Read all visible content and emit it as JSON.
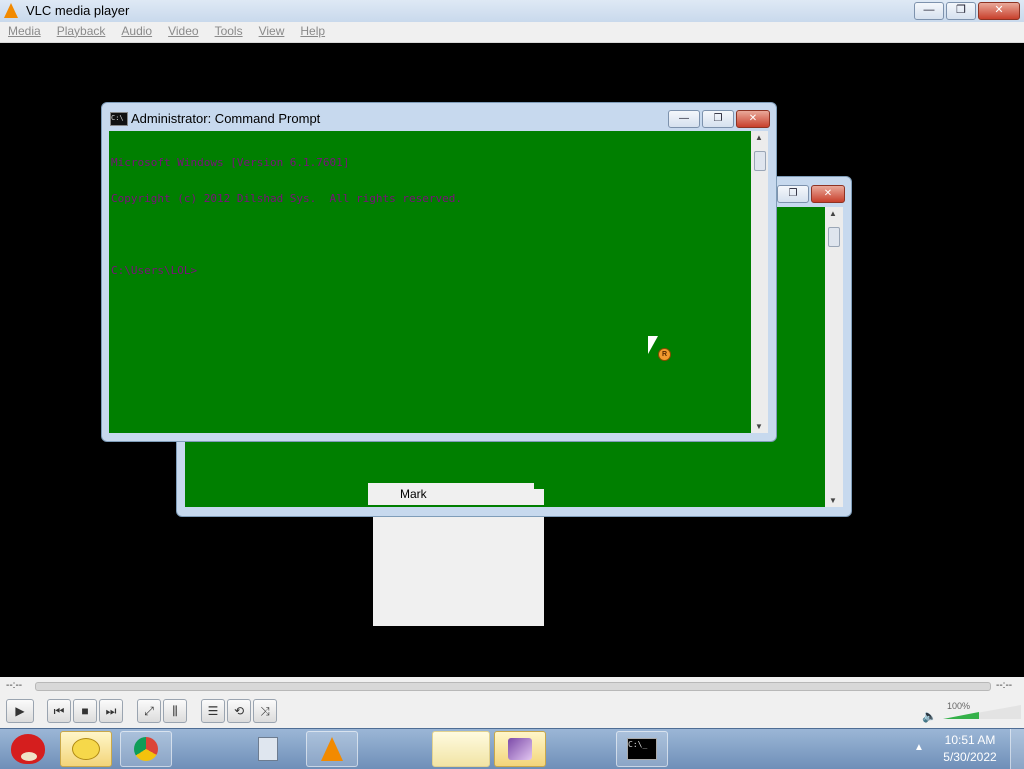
{
  "vlc": {
    "title": "VLC media player",
    "menu": [
      "Media",
      "Playback",
      "Audio",
      "Video",
      "Tools",
      "View",
      "Help"
    ],
    "window_buttons": {
      "minimize": "—",
      "restore": "❐",
      "close": "✕"
    }
  },
  "cmd": {
    "title": "Administrator: Command Prompt",
    "lines": [
      "Microsoft Windows [Version 6.1.7601]",
      "Copyright (c) 2012 Dilshad Sys.  All rights reserved.",
      "",
      "C:\\Users\\LOL>"
    ],
    "text_color": "#7b0f7b",
    "background": "#007f00"
  },
  "context_menu": {
    "items": [
      "Mark"
    ]
  },
  "cursor": {
    "badge": "R"
  },
  "player": {
    "elapsed": "--:--",
    "remaining": "--:--",
    "volume_label": "100%",
    "volume_level": 1.0,
    "buttons": {
      "play": "▶",
      "prev": "⏮",
      "stop": "■",
      "next": "⏭",
      "fullscreen": "⤢",
      "extended": "⫼",
      "playlist": "☰",
      "loop": "⟲",
      "shuffle": "⤨",
      "volume": "🔈"
    }
  },
  "taskbar": {
    "clock_time": "10:51 AM",
    "clock_date": "5/30/2022",
    "items": [
      "eggs-icon",
      "chrome-icon",
      "calculator-icon",
      "vlc-icon",
      "blank-window",
      "paint-icon",
      "cmd-icon"
    ]
  }
}
